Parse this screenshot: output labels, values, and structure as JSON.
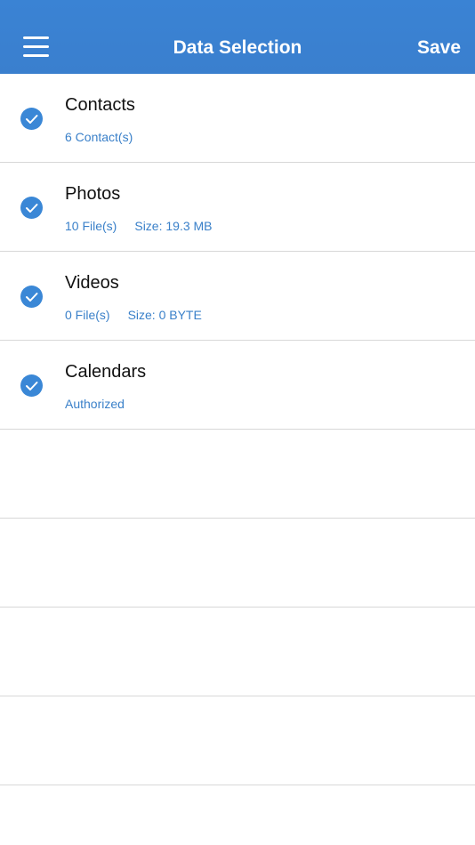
{
  "navbar": {
    "title": "Data Selection",
    "save_label": "Save",
    "menu_icon": "hamburger-menu-icon",
    "background": "#3a83d4"
  },
  "items": [
    {
      "title": "Contacts",
      "count": "6 Contact(s)",
      "size": "",
      "checked": true
    },
    {
      "title": "Photos",
      "count": "10 File(s)",
      "size": "Size: 19.3 MB",
      "checked": true
    },
    {
      "title": "Videos",
      "count": "0 File(s)",
      "size": "Size: 0 BYTE",
      "checked": true
    },
    {
      "title": "Calendars",
      "count": "Authorized",
      "size": "",
      "checked": true
    }
  ],
  "colors": {
    "accent": "#3a87d6",
    "subtext": "#3a80c9",
    "separator": "#d8d8d8"
  }
}
